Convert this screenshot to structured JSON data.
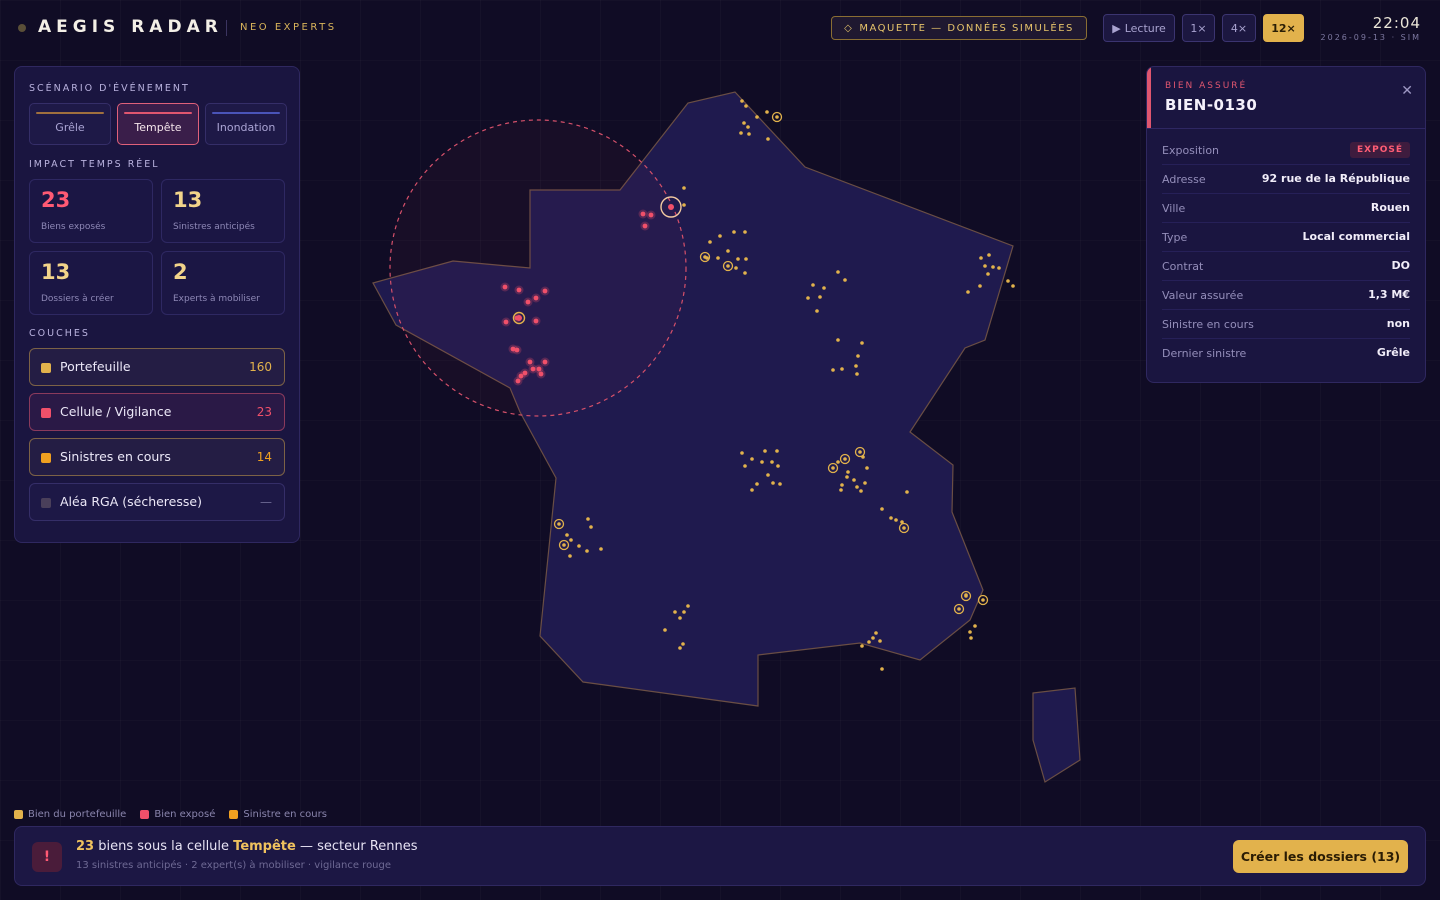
{
  "header": {
    "brand": "AEGIS RADAR",
    "brand_sub": "NEO EXPERTS",
    "mock_badge": "MAQUETTE — DONNÉES SIMULÉES",
    "mock_icon": "diamond-icon",
    "play_label": "Lecture",
    "speeds": [
      "1×",
      "4×",
      "12×"
    ],
    "active_speed": "12×",
    "clock": "22:04",
    "clock_sub": "2026-09-13 · SIM"
  },
  "left_panel": {
    "scenario_title": "SCÉNARIO D'ÉVÉNEMENT",
    "scenarios": [
      {
        "label": "Grêle",
        "color": "#a0703e"
      },
      {
        "label": "Tempête",
        "color": "#e0566f",
        "active": true
      },
      {
        "label": "Inondation",
        "color": "#4a54b8"
      }
    ],
    "impact_title": "IMPACT TEMPS RÉEL",
    "stats": [
      {
        "value": "23",
        "label": "Biens exposés",
        "color": "#ff5a74"
      },
      {
        "value": "13",
        "label": "Sinistres anticipés",
        "color": "#f2d48a"
      },
      {
        "value": "13",
        "label": "Dossiers à créer",
        "color": "#f2d48a"
      },
      {
        "value": "2",
        "label": "Experts à mobiliser",
        "color": "#f2d48a"
      }
    ],
    "layers_title": "COUCHES",
    "layers": [
      {
        "name": "Portefeuille",
        "count": "160",
        "swatch": "#e2b24c",
        "border": "#7c6246",
        "count_color": "#e2b24c"
      },
      {
        "name": "Cellule / Vigilance",
        "count": "23",
        "swatch": "#f0506a",
        "border": "#8a3a5c",
        "count_color": "#f0506a"
      },
      {
        "name": "Sinistres en cours",
        "count": "14",
        "swatch": "#f0a020",
        "border": "#7c6246",
        "count_color": "#f0a020"
      },
      {
        "name": "Aléa RGA (sécheresse)",
        "count": "—",
        "swatch": "#4a3f5a",
        "border": "#352e68",
        "count_color": "#6e6994"
      }
    ]
  },
  "detail": {
    "kicker": "BIEN ASSURÉ",
    "title": "BIEN-0130",
    "close_icon": "close-icon",
    "rows": [
      {
        "key": "Exposition",
        "value": "EXPOSÉ",
        "badge": true
      },
      {
        "key": "Adresse",
        "value": "92 rue de la République"
      },
      {
        "key": "Ville",
        "value": "Rouen"
      },
      {
        "key": "Type",
        "value": "Local commercial"
      },
      {
        "key": "Contrat",
        "value": "DO"
      },
      {
        "key": "Valeur assurée",
        "value": "1,3 M€"
      },
      {
        "key": "Sinistre en cours",
        "value": "non"
      },
      {
        "key": "Dernier sinistre",
        "value": "Grêle"
      }
    ]
  },
  "legend": [
    {
      "label": "Bien du portefeuille",
      "color": "#e2b24c"
    },
    {
      "label": "Bien exposé",
      "color": "#f0506a"
    },
    {
      "label": "Sinistre en cours",
      "color": "#f0a020"
    }
  ],
  "alert": {
    "count": "23",
    "text1": " biens sous la cellule ",
    "event": "Tempête",
    "text2": " — secteur Rennes",
    "sub": "13 sinistres anticipés · 2 expert(s) à mobiliser · vigilance rouge",
    "icon": "alert-icon",
    "cta": "Créer les dossiers (13)"
  }
}
